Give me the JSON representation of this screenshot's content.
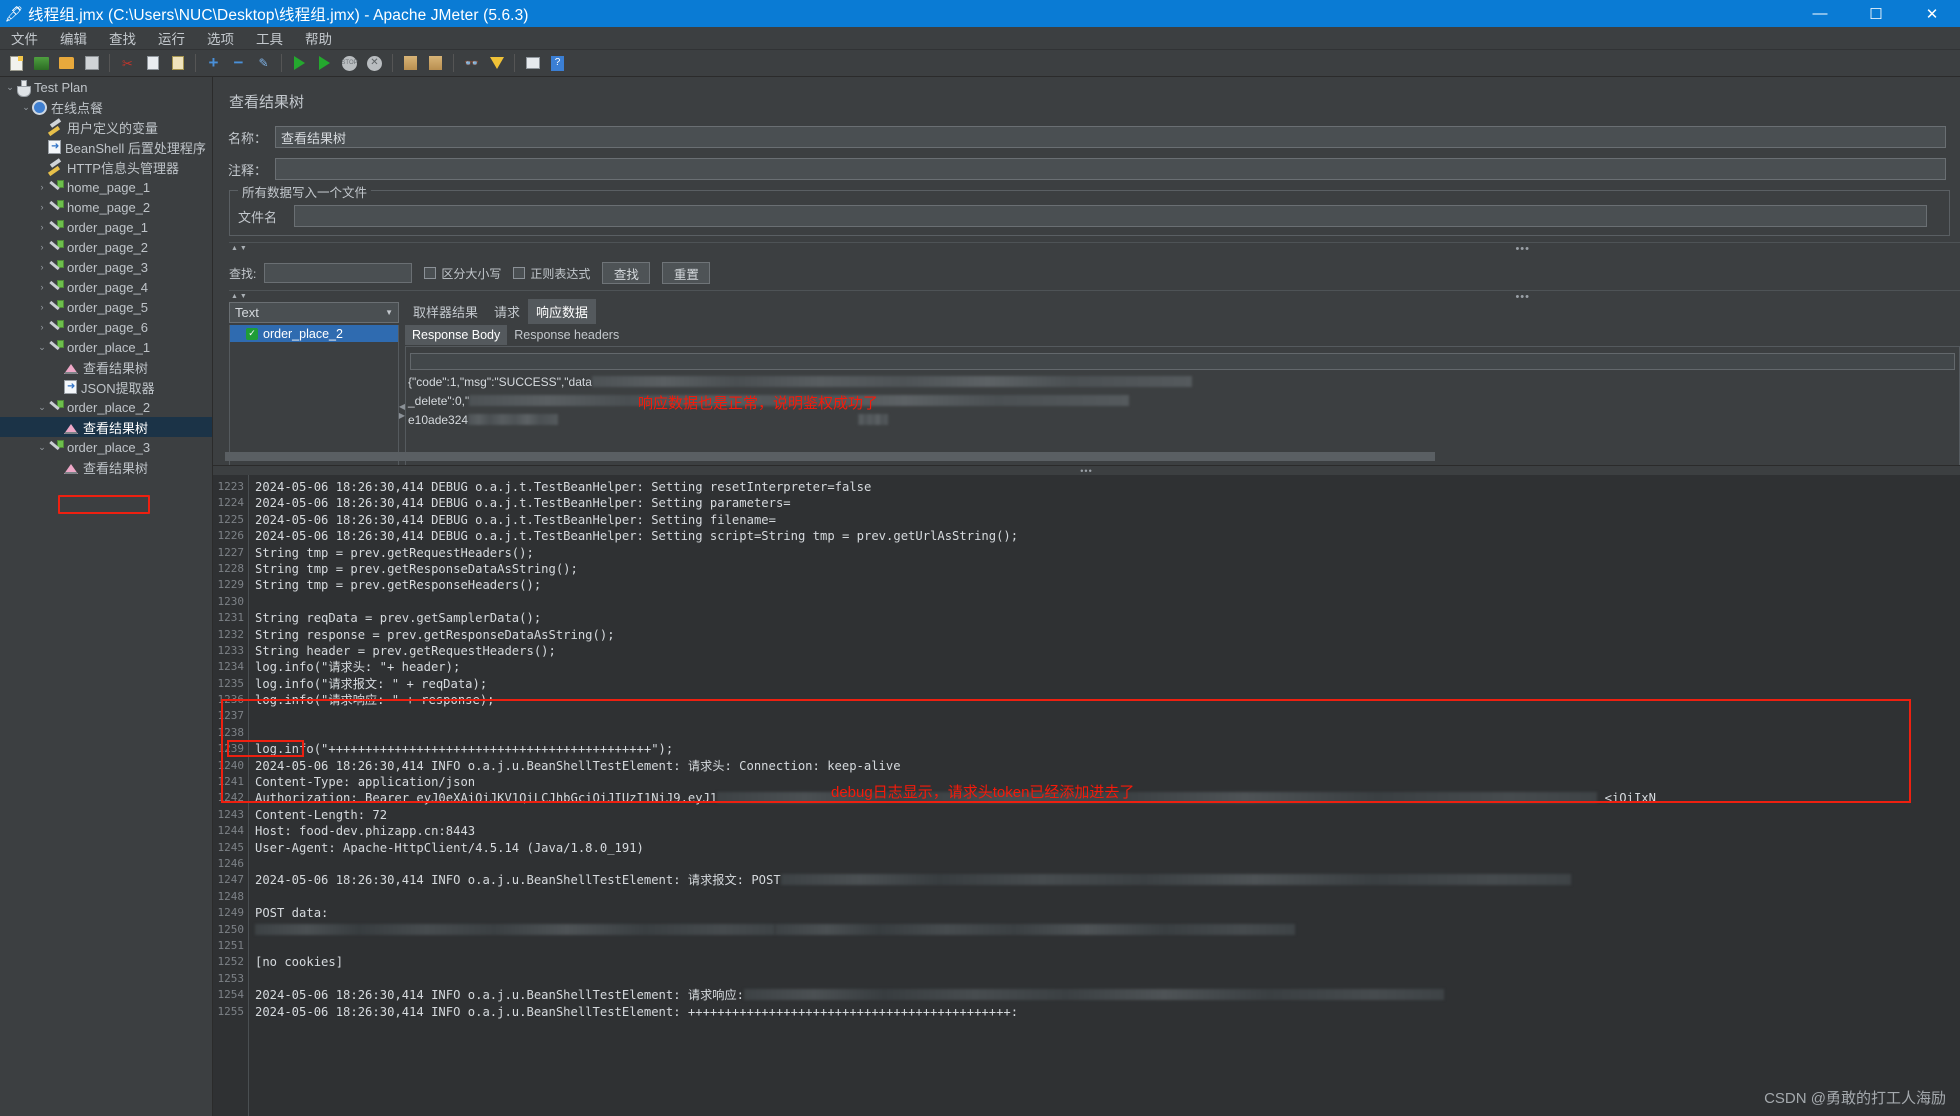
{
  "window": {
    "title": "线程组.jmx (C:\\Users\\NUC\\Desktop\\线程组.jmx) - Apache JMeter (5.6.3)",
    "app_icon": "jmeter-feather-icon",
    "accent": "#0a7bd4",
    "minimize_label": "—",
    "maximize_label": "☐",
    "close_label": "✕"
  },
  "menubar": {
    "items": [
      {
        "label": "文件"
      },
      {
        "label": "编辑"
      },
      {
        "label": "查找"
      },
      {
        "label": "运行"
      },
      {
        "label": "选项"
      },
      {
        "label": "工具"
      },
      {
        "label": "帮助"
      }
    ]
  },
  "toolbar": {
    "buttons": [
      {
        "name": "new-icon"
      },
      {
        "name": "templates-icon"
      },
      {
        "name": "open-icon"
      },
      {
        "name": "save-icon"
      },
      {
        "name": "cut-icon"
      },
      {
        "name": "copy-icon"
      },
      {
        "name": "paste-icon"
      },
      {
        "name": "expand-all-icon"
      },
      {
        "name": "collapse-all-icon"
      },
      {
        "name": "toggle-icon"
      },
      {
        "name": "start-icon"
      },
      {
        "name": "start-no-pauses-icon"
      },
      {
        "name": "stop-icon"
      },
      {
        "name": "shutdown-icon"
      },
      {
        "name": "clear-icon"
      },
      {
        "name": "clear-all-icon"
      },
      {
        "name": "search-icon"
      },
      {
        "name": "reset-search-icon"
      },
      {
        "name": "function-helper-icon"
      },
      {
        "name": "help-icon"
      }
    ]
  },
  "tree": {
    "nodes": [
      {
        "label": "Test Plan",
        "icon": "flask-icon",
        "indent": 0,
        "twist": "open",
        "selected": false
      },
      {
        "label": "在线点餐",
        "icon": "thread-group-icon",
        "indent": 1,
        "twist": "open",
        "selected": false
      },
      {
        "label": "用户定义的变量",
        "icon": "config-wrench-icon",
        "indent": 2,
        "twist": "",
        "selected": false
      },
      {
        "label": "BeanShell 后置处理程序",
        "icon": "beanshell-icon",
        "indent": 2,
        "twist": "",
        "selected": false
      },
      {
        "label": "HTTP信息头管理器",
        "icon": "config-wrench-icon",
        "indent": 2,
        "twist": "",
        "selected": false
      },
      {
        "label": "home_page_1",
        "icon": "sampler-icon",
        "indent": 2,
        "twist": "closed",
        "selected": false
      },
      {
        "label": "home_page_2",
        "icon": "sampler-icon",
        "indent": 2,
        "twist": "closed",
        "selected": false
      },
      {
        "label": "order_page_1",
        "icon": "sampler-icon",
        "indent": 2,
        "twist": "closed",
        "selected": false
      },
      {
        "label": "order_page_2",
        "icon": "sampler-icon",
        "indent": 2,
        "twist": "closed",
        "selected": false
      },
      {
        "label": "order_page_3",
        "icon": "sampler-icon",
        "indent": 2,
        "twist": "closed",
        "selected": false
      },
      {
        "label": "order_page_4",
        "icon": "sampler-icon",
        "indent": 2,
        "twist": "closed",
        "selected": false
      },
      {
        "label": "order_page_5",
        "icon": "sampler-icon",
        "indent": 2,
        "twist": "closed",
        "selected": false
      },
      {
        "label": "order_page_6",
        "icon": "sampler-icon",
        "indent": 2,
        "twist": "closed",
        "selected": false
      },
      {
        "label": "order_place_1",
        "icon": "sampler-icon",
        "indent": 2,
        "twist": "open",
        "selected": false
      },
      {
        "label": "查看结果树",
        "icon": "view-results-tree-icon",
        "indent": 3,
        "twist": "",
        "selected": false
      },
      {
        "label": "JSON提取器",
        "icon": "beanshell-icon",
        "indent": 3,
        "twist": "",
        "selected": false
      },
      {
        "label": "order_place_2",
        "icon": "sampler-icon",
        "indent": 2,
        "twist": "open",
        "selected": false
      },
      {
        "label": "查看结果树",
        "icon": "view-results-tree-icon",
        "indent": 3,
        "twist": "",
        "selected": true
      },
      {
        "label": "order_place_3",
        "icon": "sampler-icon",
        "indent": 2,
        "twist": "open",
        "selected": false
      },
      {
        "label": "查看结果树",
        "icon": "view-results-tree-icon",
        "indent": 3,
        "twist": "",
        "selected": false
      }
    ]
  },
  "panel": {
    "title": "查看结果树",
    "name_label": "名称：",
    "name_value": "查看结果树",
    "comment_label": "注释：",
    "comment_value": "",
    "file_group_legend": "所有数据写入一个文件",
    "filename_label": "文件名",
    "filename_value": "",
    "search": {
      "label": "查找:",
      "value": "",
      "placeholder": "",
      "case_sensitive_label": "区分大小写",
      "regex_label": "正则表达式",
      "find_button": "查找",
      "reset_button": "重置"
    },
    "renderer_selected": "Text",
    "renderer_options": [
      "Text"
    ],
    "results": [
      {
        "label": "order_place_2",
        "status": "success",
        "selected": true
      }
    ],
    "tabs": [
      {
        "label": "取样器结果",
        "active": false
      },
      {
        "label": "请求",
        "active": false
      },
      {
        "label": "响应数据",
        "active": true
      }
    ],
    "subtabs": [
      {
        "label": "Response Body",
        "active": true
      },
      {
        "label": "Response headers",
        "active": false
      }
    ],
    "response_lines": [
      "{\"code\":1,\"msg\":\"SUCCESS\",\"data",
      "_delete\":0,\"",
      "e10ade324"
    ],
    "response_annotation": "响应数据也是正常，说明鉴权成功了",
    "annotation_color": "#f51a0a"
  },
  "log": {
    "first_line_number": 1223,
    "lines": [
      {
        "n": 1223,
        "text": "2024-05-06 18:26:30,414 DEBUG o.a.j.t.TestBeanHelper: Setting resetInterpreter=false"
      },
      {
        "n": 1224,
        "text": "2024-05-06 18:26:30,414 DEBUG o.a.j.t.TestBeanHelper: Setting parameters="
      },
      {
        "n": 1225,
        "text": "2024-05-06 18:26:30,414 DEBUG o.a.j.t.TestBeanHelper: Setting filename="
      },
      {
        "n": 1226,
        "text": "2024-05-06 18:26:30,414 DEBUG o.a.j.t.TestBeanHelper: Setting script=String tmp = prev.getUrlAsString();"
      },
      {
        "n": 1227,
        "text": "String tmp = prev.getRequestHeaders();"
      },
      {
        "n": 1228,
        "text": "String tmp = prev.getResponseDataAsString();"
      },
      {
        "n": 1229,
        "text": "String tmp = prev.getResponseHeaders();"
      },
      {
        "n": 1230,
        "text": ""
      },
      {
        "n": 1231,
        "text": "String reqData = prev.getSamplerData();"
      },
      {
        "n": 1232,
        "text": "String response = prev.getResponseDataAsString();"
      },
      {
        "n": 1233,
        "text": "String header = prev.getRequestHeaders();"
      },
      {
        "n": 1234,
        "text": "log.info(\"请求头: \"+ header);"
      },
      {
        "n": 1235,
        "text": "log.info(\"请求报文: \" + reqData);"
      },
      {
        "n": 1236,
        "text": "log.info(\"请求响应: \" + response);"
      },
      {
        "n": 1237,
        "text": ""
      },
      {
        "n": 1238,
        "text": ""
      },
      {
        "n": 1239,
        "text": "log.info(\"++++++++++++++++++++++++++++++++++++++++++++\");"
      },
      {
        "n": 1240,
        "text": "2024-05-06 18:26:30,414 INFO o.a.j.u.BeanShellTestElement: 请求头: Connection: keep-alive"
      },
      {
        "n": 1241,
        "text": "Content-Type: application/json"
      },
      {
        "n": 1242,
        "text": "Authorization: Bearer eyJ0eXAiOiJKV1QiLCJhbGciOiJIUzI1NiJ9.eyJ1"
      },
      {
        "n": 1243,
        "text": "Content-Length: 72"
      },
      {
        "n": 1244,
        "text": "Host: food-dev.phizapp.cn:8443"
      },
      {
        "n": 1245,
        "text": "User-Agent: Apache-HttpClient/4.5.14 (Java/1.8.0_191)"
      },
      {
        "n": 1246,
        "text": ""
      },
      {
        "n": 1247,
        "text": "2024-05-06 18:26:30,414 INFO o.a.j.u.BeanShellTestElement: 请求报文: POST"
      },
      {
        "n": 1248,
        "text": ""
      },
      {
        "n": 1249,
        "text": "POST data:"
      },
      {
        "n": 1250,
        "text": ""
      },
      {
        "n": 1251,
        "text": ""
      },
      {
        "n": 1252,
        "text": "[no cookies]"
      },
      {
        "n": 1253,
        "text": ""
      },
      {
        "n": 1254,
        "text": "2024-05-06 18:26:30,414 INFO o.a.j.u.BeanShellTestElement: 请求响应:"
      },
      {
        "n": 1255,
        "text": "2024-05-06 18:26:30,414 INFO o.a.j.u.BeanShellTestElement: ++++++++++++++++++++++++++++++++++++++++++++:"
      }
    ],
    "authorization_highlight_label": "Authorization:",
    "annotation": "debug日志显示，请求头token已经添加进去了",
    "annotation_color": "#f51a0a",
    "tail_fragment": "<iOiIxN"
  },
  "watermark": "CSDN @勇敢的打工人海励"
}
